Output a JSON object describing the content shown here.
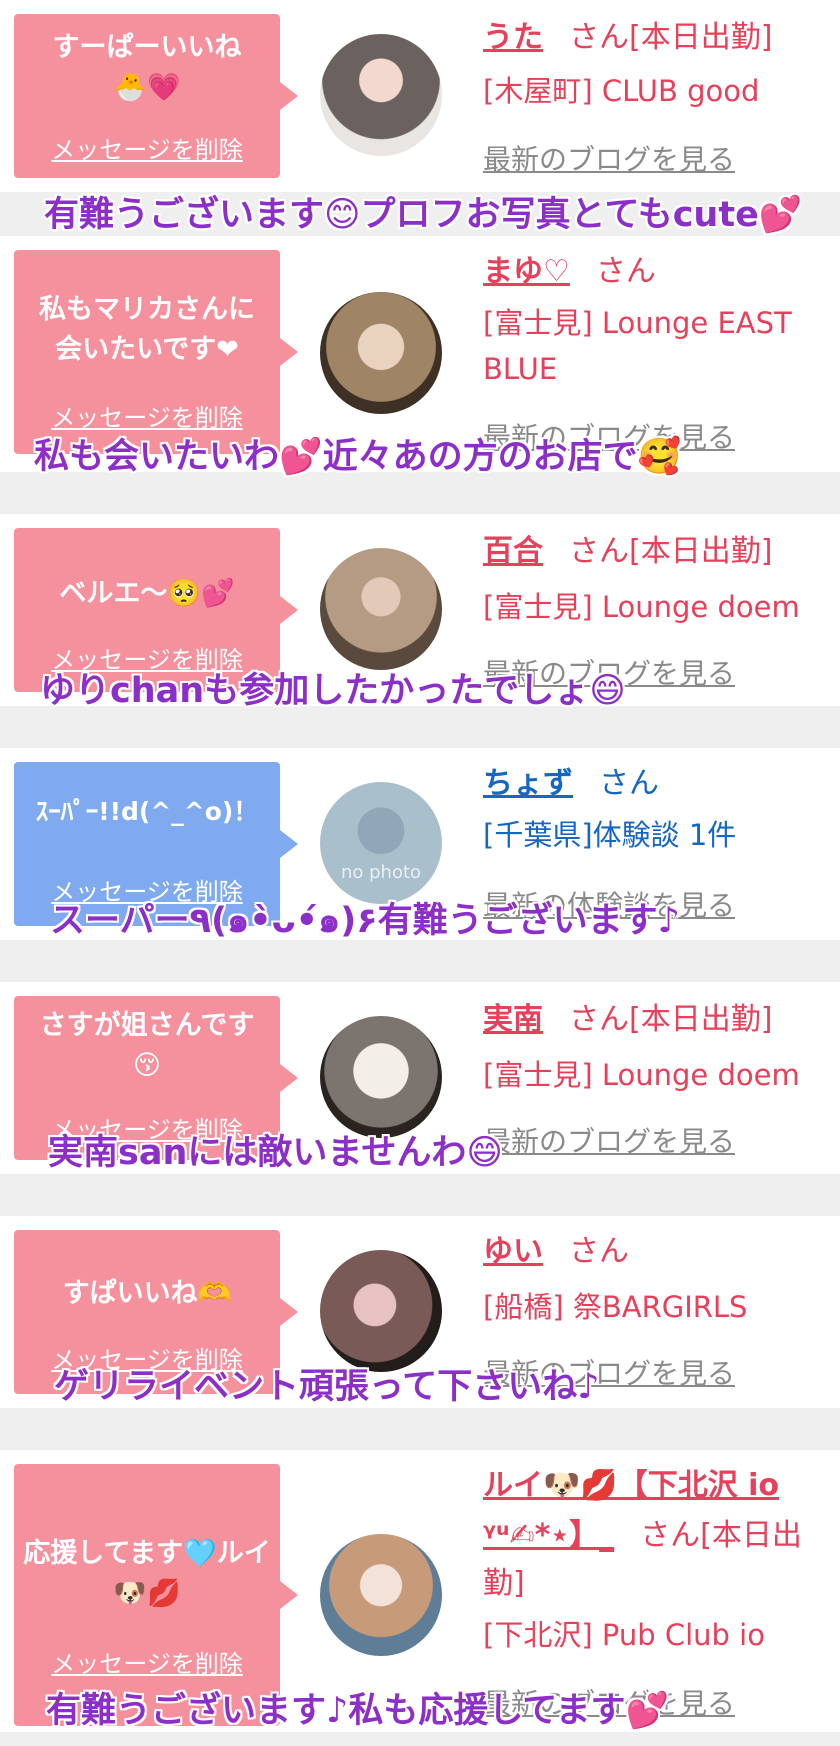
{
  "entries": [
    {
      "bubble_text": "すーぱーいいね🐣💗",
      "delete_label": "メッセージを削除",
      "name": "うた",
      "san": "さん[本日出勤]",
      "shop": "[木屋町] CLUB good",
      "blog": "最新のブログを見る",
      "overlay": "有難うございます😊プロフお写真とてもcute💕"
    },
    {
      "bubble_text": "私もマリカさんに会いたいです❤",
      "delete_label": "メッセージを削除",
      "name": "まゆ♡",
      "san": "さん",
      "shop": "[富士見] Lounge EAST BLUE",
      "blog": "最新のブログを見る",
      "overlay": "私も会いたいわ💕近々あの方のお店で🥰"
    },
    {
      "bubble_text": "ベルエ〜🥺💕",
      "delete_label": "メッセージを削除",
      "name": "百合",
      "san": "さん[本日出勤]",
      "shop": "[富士見] Lounge doem",
      "blog": "最新のブログを見る",
      "overlay": "ゆりchanも参加したかったでしょ😄"
    },
    {
      "bubble_text": "ｽｰﾊﾟｰ!!d(^_^o)！",
      "delete_label": "メッセージを削除",
      "name": "ちょず",
      "san": "さん",
      "shop": "[千葉県]体験談 1件",
      "blog": "最新の体験談を見る",
      "overlay": "スーパー٩(๑•̀ᴗ•́๑)۶有難うございます♪",
      "avatar_text": "no photo"
    },
    {
      "bubble_text": "さすが姐さんです😚",
      "delete_label": "メッセージを削除",
      "name": "実南",
      "san": "さん[本日出勤]",
      "shop": "[富士見] Lounge doem",
      "blog": "最新のブログを見る",
      "overlay": "実南sanには敵いませんわ😄"
    },
    {
      "bubble_text": "すぱいいね🫶",
      "delete_label": "メッセージを削除",
      "name": "ゆい",
      "san": "さん",
      "shop": "[船橋] 祭BARGIRLS",
      "blog": "最新のブログを見る",
      "overlay": "ゲリライベント頑張って下さいね♪"
    },
    {
      "bubble_text": "応援してます🩵ルイ🐶💋",
      "delete_label": "メッセージを削除",
      "name": "ルイ🐶💋【下北沢 io ",
      "name2": "ᵞᵘ✍︎*⋆】_",
      "san": "さん[本日出",
      "san2": "勤]",
      "shop": "[下北沢] Pub Club io",
      "blog": "最新のブログを見る",
      "overlay": "有難うございます♪私も応援してます💕"
    }
  ],
  "colors": {
    "pink_bubble": "#f5909d",
    "blue_bubble": "#7faaf0",
    "name_red": "#e6405a",
    "name_blue": "#1666c4",
    "overlay_purple": "#8c2fc9"
  }
}
